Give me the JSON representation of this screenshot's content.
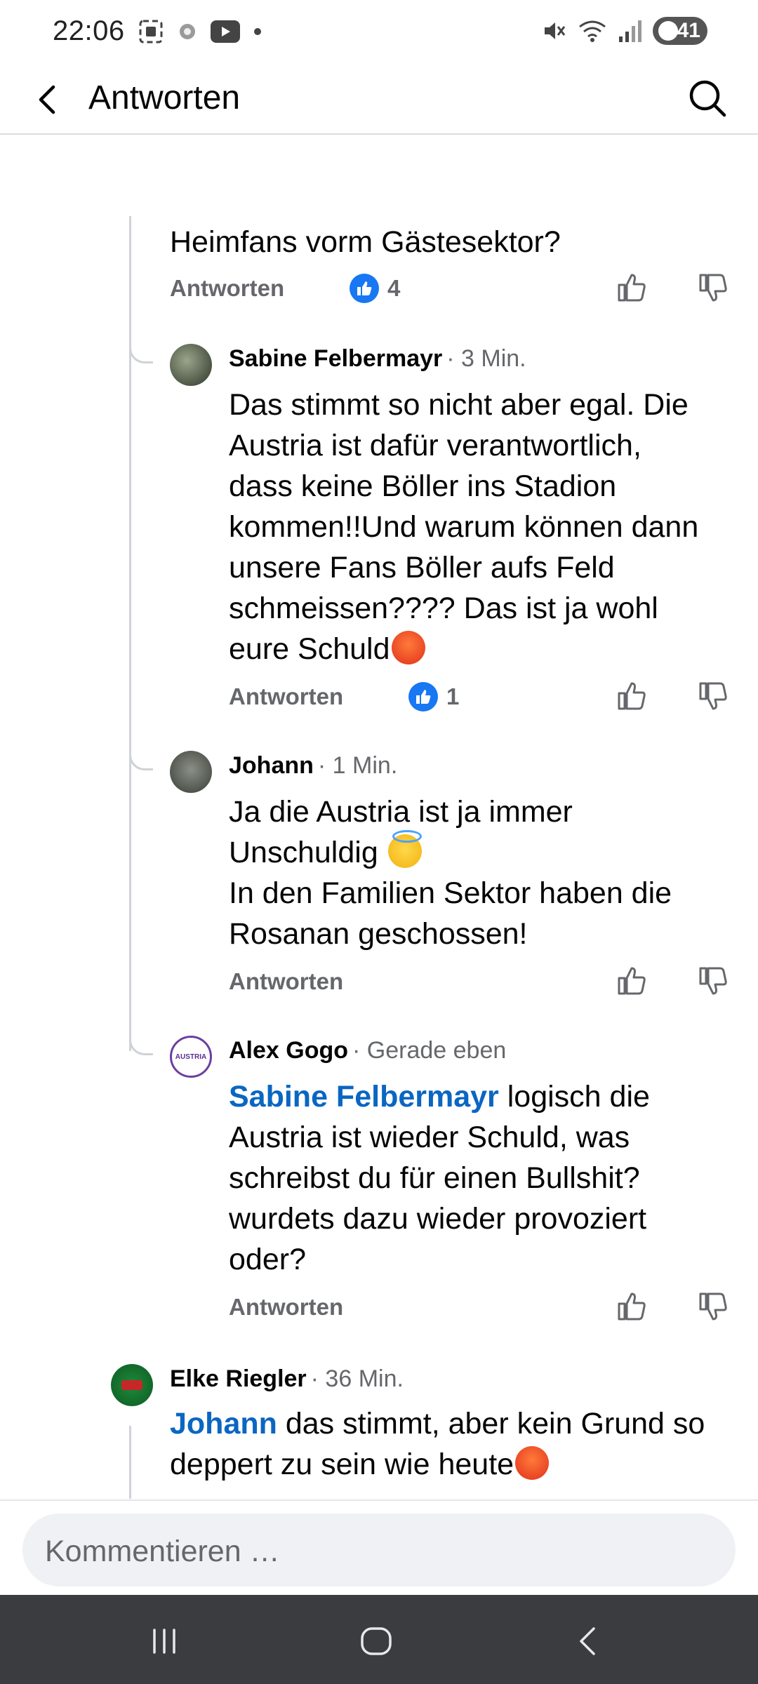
{
  "status_bar": {
    "time": "22:06",
    "battery": "41",
    "icons": [
      "screenshot-icon",
      "settings-dot-icon",
      "youtube-icon",
      "dot-icon",
      "mute-icon",
      "wifi-icon",
      "signal-icon",
      "battery-icon"
    ]
  },
  "header": {
    "title": "Antworten",
    "back_icon": "chevron-left-icon",
    "search_icon": "search-icon"
  },
  "comments": [
    {
      "text": "Heimfans vorm Gästesektor?",
      "reply_label": "Antworten",
      "reaction_count": "4"
    },
    {
      "author": "Sabine Felbermayr",
      "time": "· 3 Min.",
      "lines": [
        "Das stimmt so nicht aber egal. Die",
        "Austria ist dafür verantwortlich,",
        "dass keine Böller ins Stadion",
        "kommen!!Und warum können dann",
        "unsere Fans Böller  aufs Feld",
        "schmeissen???? Das ist ja wohl",
        "eure Schuld"
      ],
      "emoji": "angry-face-emoji",
      "reply_label": "Antworten",
      "reaction_count": "1"
    },
    {
      "author": "Johann",
      "time": "· 1 Min.",
      "lines": [
        "Ja die Austria ist ja immer",
        "Unschuldig ",
        "In den Familien Sektor haben die",
        "Rosanan geschossen!"
      ],
      "emoji": "smiling-face-with-halo-emoji",
      "reply_label": "Antworten"
    },
    {
      "author": "Alex Gogo",
      "time": "· Gerade eben",
      "mention": "Sabine Felbermayr",
      "lines": [
        " logisch die",
        "Austria ist wieder Schuld, was",
        "schreibst du für einen Bullshit?",
        "wurdets dazu wieder provoziert",
        "oder?"
      ],
      "reply_label": "Antworten",
      "avatar_text": "AUSTRIA"
    },
    {
      "author": "Elke Riegler",
      "time": "· 36 Min.",
      "mention": "Johann",
      "lines": [
        " das stimmt, aber kein Grund so",
        "deppert zu sein wie heute"
      ],
      "emoji": "angry-face-emoji"
    }
  ],
  "composer": {
    "placeholder": "Kommentieren …"
  },
  "navbar": {
    "icons": [
      "recent-apps-icon",
      "home-icon",
      "back-icon"
    ]
  }
}
